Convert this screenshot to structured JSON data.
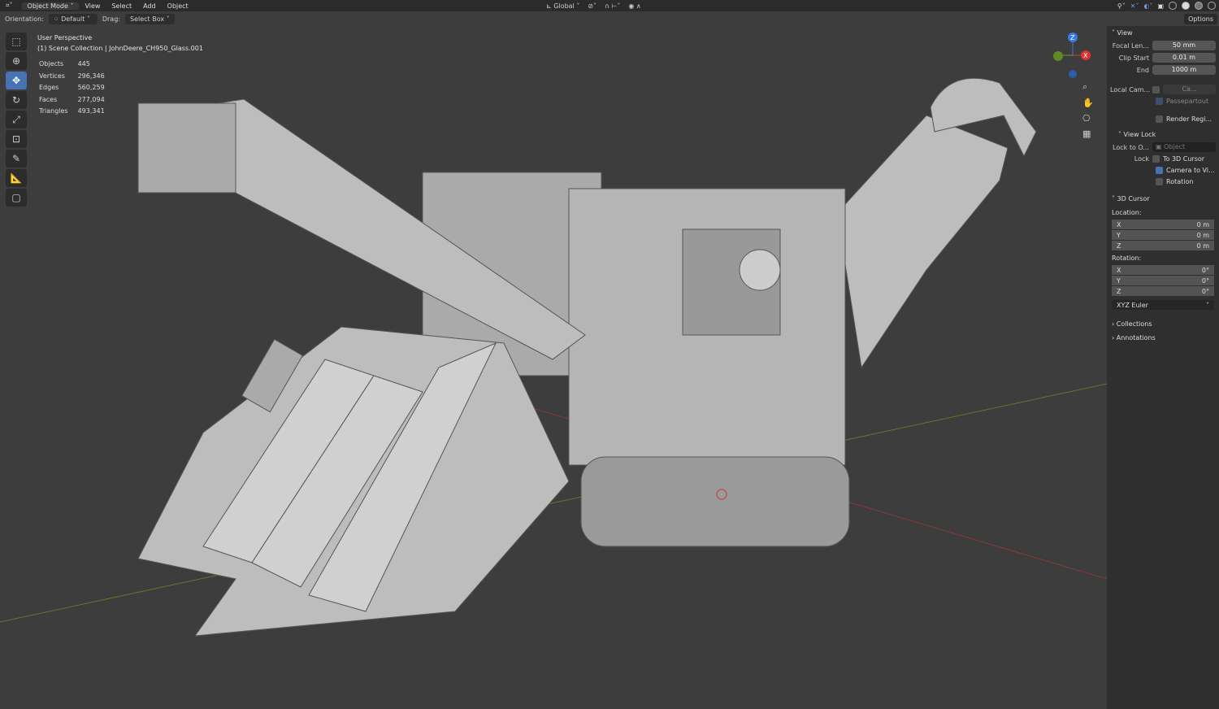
{
  "header": {
    "mode": "Object Mode",
    "menus": [
      "View",
      "Select",
      "Add",
      "Object"
    ],
    "transform": "Global",
    "options": "Options"
  },
  "toolbar": {
    "orientation_label": "Orientation:",
    "orientation": "Default",
    "drag_label": "Drag:",
    "drag": "Select Box"
  },
  "overlay": {
    "perspective": "User Perspective",
    "collection": "(1) Scene Collection | JohnDeere_CH950_Glass.001",
    "stats": [
      {
        "k": "Objects",
        "v": "445"
      },
      {
        "k": "Vertices",
        "v": "296,346"
      },
      {
        "k": "Edges",
        "v": "560,259"
      },
      {
        "k": "Faces",
        "v": "277,094"
      },
      {
        "k": "Triangles",
        "v": "493,341"
      }
    ]
  },
  "gizmo": {
    "z": "Z",
    "x": "X"
  },
  "sidebar": {
    "view": {
      "title": "View",
      "focal_label": "Focal Len...",
      "focal": "50 mm",
      "clip_start_label": "Clip Start",
      "clip_start": "0.01 m",
      "end_label": "End",
      "end": "1000 m",
      "local_cam_label": "Local Cam...",
      "local_cam": "Ca...",
      "passepartout": "Passepartout",
      "render_region": "Render Regi..."
    },
    "view_lock": {
      "title": "View Lock",
      "lock_to_label": "Lock to O...",
      "lock_to": "Object",
      "lock_label": "Lock",
      "to_cursor": "To 3D Cursor",
      "camera_to_view": "Camera to Vi...",
      "rotation": "Rotation"
    },
    "cursor": {
      "title": "3D Cursor",
      "location_label": "Location:",
      "loc": [
        {
          "k": "X",
          "v": "0 m"
        },
        {
          "k": "Y",
          "v": "0 m"
        },
        {
          "k": "Z",
          "v": "0 m"
        }
      ],
      "rotation_label": "Rotation:",
      "rot": [
        {
          "k": "X",
          "v": "0°"
        },
        {
          "k": "Y",
          "v": "0°"
        },
        {
          "k": "Z",
          "v": "0°"
        }
      ],
      "mode": "XYZ Euler"
    },
    "collections": "Collections",
    "annotations": "Annotations"
  }
}
